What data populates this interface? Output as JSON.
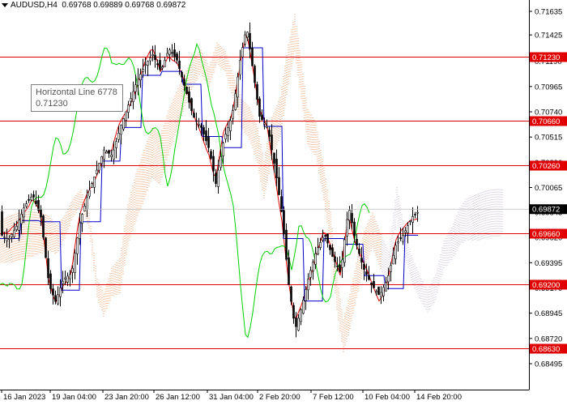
{
  "header": {
    "symbol": "AUDUSD,H4",
    "ohlc": "0.69768 0.69889 0.69768 0.69872"
  },
  "tooltip": {
    "title": "Horizontal Line 6778",
    "value": "0.71230"
  },
  "price_axis": {
    "ticks": [
      "0.71635",
      "0.71425",
      "0.71190",
      "0.70965",
      "0.70740",
      "0.70515",
      "0.70290",
      "0.70065",
      "0.69845",
      "0.69620",
      "0.69395",
      "0.69170",
      "0.68945",
      "0.68720",
      "0.68495"
    ],
    "current_price": "0.69872"
  },
  "time_axis": {
    "labels": [
      "16 Jan 2023",
      "19 Jan 04:00",
      "23 Jan 20:00",
      "26 Jan 12:00",
      "31 Jan 04:00",
      "2 Feb 20:00",
      "7 Feb 12:00",
      "10 Feb 04:00",
      "14 Feb 20:00"
    ]
  },
  "levels": [
    {
      "label": "0.71230",
      "price": 0.7123
    },
    {
      "label": "0.70660",
      "price": 0.7066
    },
    {
      "label": "0.70260",
      "price": 0.7026
    },
    {
      "label": "0.69660",
      "price": 0.6966
    },
    {
      "label": "0.69200",
      "price": 0.692
    },
    {
      "label": "0.68630",
      "price": 0.6863
    }
  ],
  "colors": {
    "level_line": "#e00000",
    "level_tag": "#e00000",
    "candle": "#000000",
    "tenkan": "#e00000",
    "kijun": "#0000c8",
    "chikou": "#00d000",
    "kumo_bear": "#e07830",
    "kumo_bull": "#b0a0c8",
    "current_tag": "#000000"
  }
}
